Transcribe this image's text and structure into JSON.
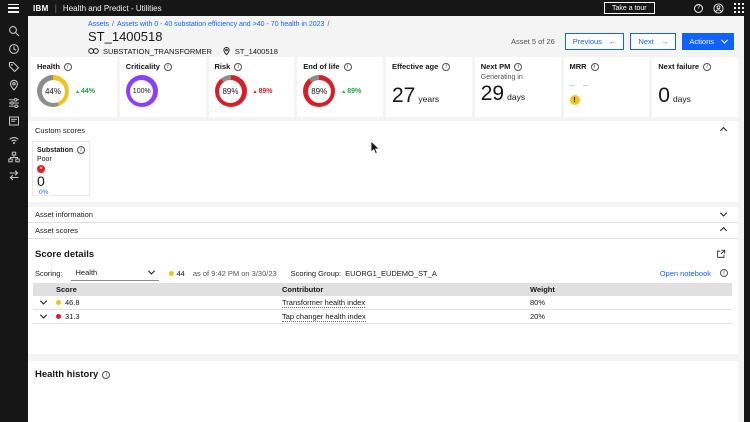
{
  "header": {
    "brand": "IBM",
    "separator": "|",
    "app_title": "Health and Predict - Utilities",
    "tour_button": "Take a tour"
  },
  "breadcrumb": {
    "items": [
      "Assets",
      "Assets with 0 - 40 substation efficiency and >40 - 70 health in 2023"
    ],
    "separator": "/"
  },
  "asset": {
    "title": "ST_1400518",
    "asset_class": "SUBSTATION_TRANSFORMER",
    "location": "ST_1400518"
  },
  "pagination": {
    "count_label": "Asset 5 of 26",
    "previous": "Previous",
    "next": "Next",
    "actions": "Actions"
  },
  "kpi_cards": [
    {
      "label": "Health",
      "percent": 44,
      "display": "44%",
      "ring": "#f1c21b",
      "delta": "44%",
      "delta_color": "#24a148"
    },
    {
      "label": "Criticality",
      "percent": 100,
      "display": "100%",
      "ring": "#8a3ffc"
    },
    {
      "label": "Risk",
      "percent": 89,
      "display": "89%",
      "ring": "#da1e28",
      "delta": "89%",
      "delta_color": "#da1e28"
    },
    {
      "label": "End of life",
      "percent": 89,
      "display": "89%",
      "ring": "#da1e28",
      "delta": "89%",
      "delta_color": "#24a148"
    },
    {
      "label": "Effective age",
      "value": "27",
      "unit": "years"
    },
    {
      "label": "Next PM",
      "pre": "Generating in",
      "value": "29",
      "unit": "days"
    },
    {
      "label": "MRR",
      "empty": "– –"
    },
    {
      "label": "Next failure",
      "value": "0",
      "unit": "days"
    }
  ],
  "custom_scores": {
    "header": "Custom scores",
    "card": {
      "title": "Substation E...",
      "rating": "Poor",
      "value": "0",
      "percent": "0%",
      "percent_color": "#0f62fe"
    }
  },
  "sections": {
    "asset_information": "Asset information",
    "asset_scores": "Asset scores"
  },
  "score_details": {
    "title": "Score details",
    "scoring_label": "Scoring:",
    "dropdown_value": "Health",
    "score": "44",
    "score_dot": "#f1c21b",
    "as_of": "as of 9:42 PM on 3/30/23",
    "group_label": "Scoring Group:",
    "group_value": "EUORG1_EUDEMO_ST_A",
    "open_notebook": "Open notebook",
    "columns": [
      "Score",
      "Contributor",
      "Weight"
    ],
    "rows": [
      {
        "score": "46.8",
        "dot": "#f1c21b",
        "contributor": "Transformer health index",
        "weight": "80%"
      },
      {
        "score": "31.3",
        "dot": "#da1e28",
        "contributor": "Tap changer health index",
        "weight": "20%"
      }
    ]
  },
  "health_history": {
    "title": "Health history"
  },
  "colors": {
    "accent": "#0f62fe",
    "warning": "#f1c21b",
    "danger": "#da1e28",
    "success": "#24a148",
    "purple": "#8a3ffc"
  }
}
